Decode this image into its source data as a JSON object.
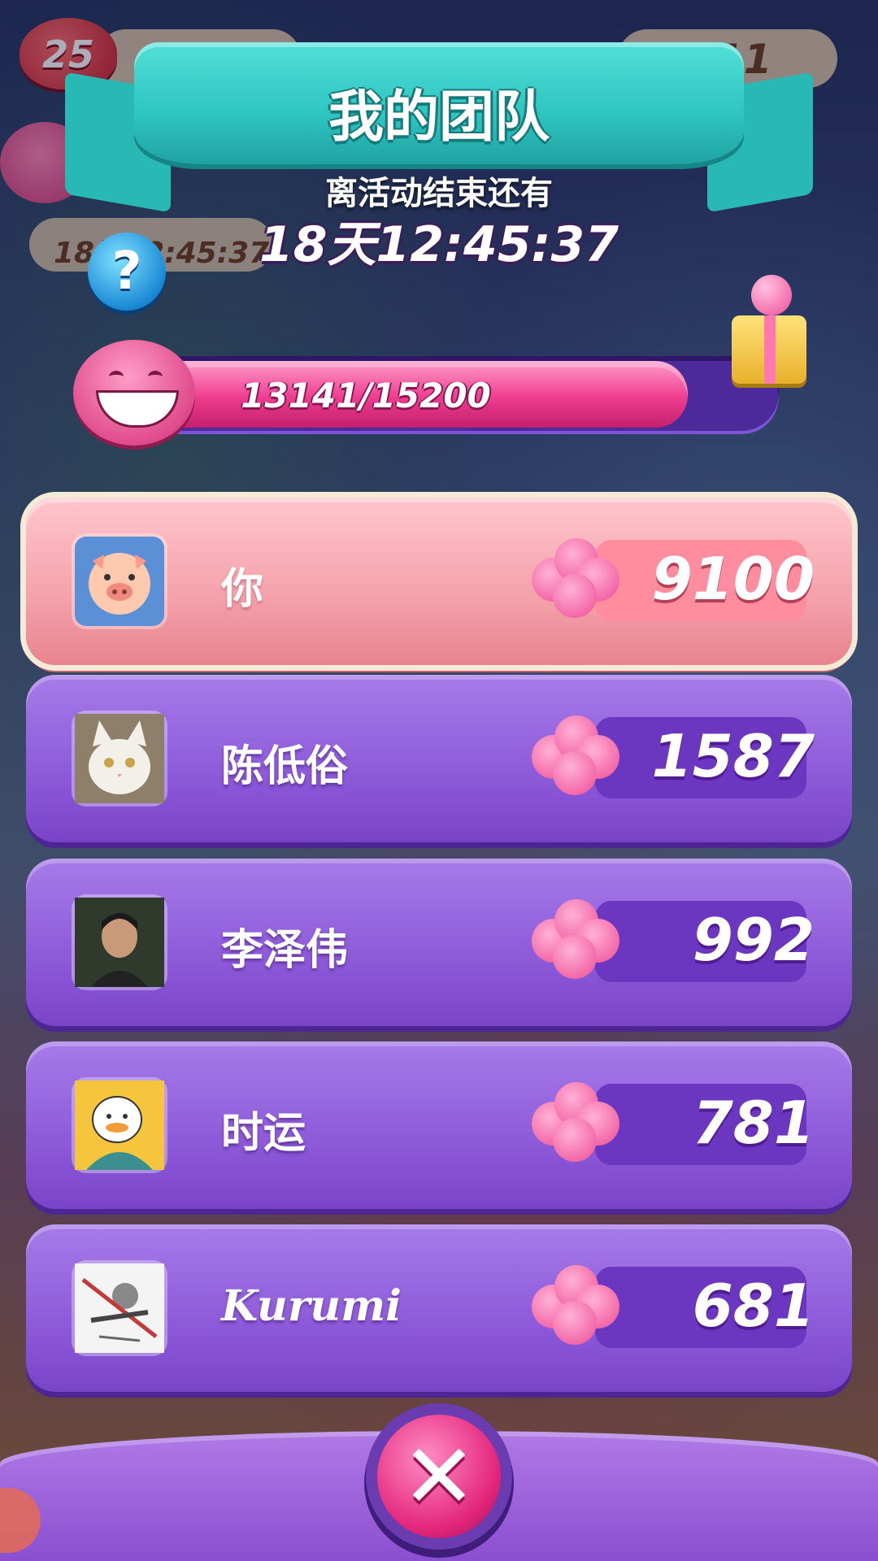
{
  "hud": {
    "lives": "25",
    "right_counter": "11",
    "timer": "18天12:45:37"
  },
  "header": {
    "title": "我的团队",
    "countdown_label": "离活动结束还有",
    "countdown_value": "18天12:45:37"
  },
  "progress": {
    "current": 13141,
    "goal": 15200,
    "label": "13141/15200"
  },
  "team": [
    {
      "name": "你",
      "score": "9100",
      "is_self": true,
      "avatar": "pig-avatar"
    },
    {
      "name": "陈低俗",
      "score": "1587",
      "is_self": false,
      "avatar": "white-cat-avatar"
    },
    {
      "name": "李泽伟",
      "score": "992",
      "is_self": false,
      "avatar": "man-photo-avatar"
    },
    {
      "name": "时运",
      "score": "781",
      "is_self": false,
      "avatar": "duck-cartoon-avatar"
    },
    {
      "name": "Kurumi",
      "score": "681",
      "is_self": false,
      "avatar": "sketch-avatar"
    }
  ],
  "icons": {
    "help": "question-icon",
    "close": "close-icon",
    "score": "candy-icon",
    "reward": "gift-icon"
  },
  "colors": {
    "ribbon": "#2ec4bf",
    "row_purple": "#8d5ad9",
    "row_self": "#f4a1aa",
    "progress_fill": "#ee3d8f",
    "close_button": "#e3267d"
  }
}
